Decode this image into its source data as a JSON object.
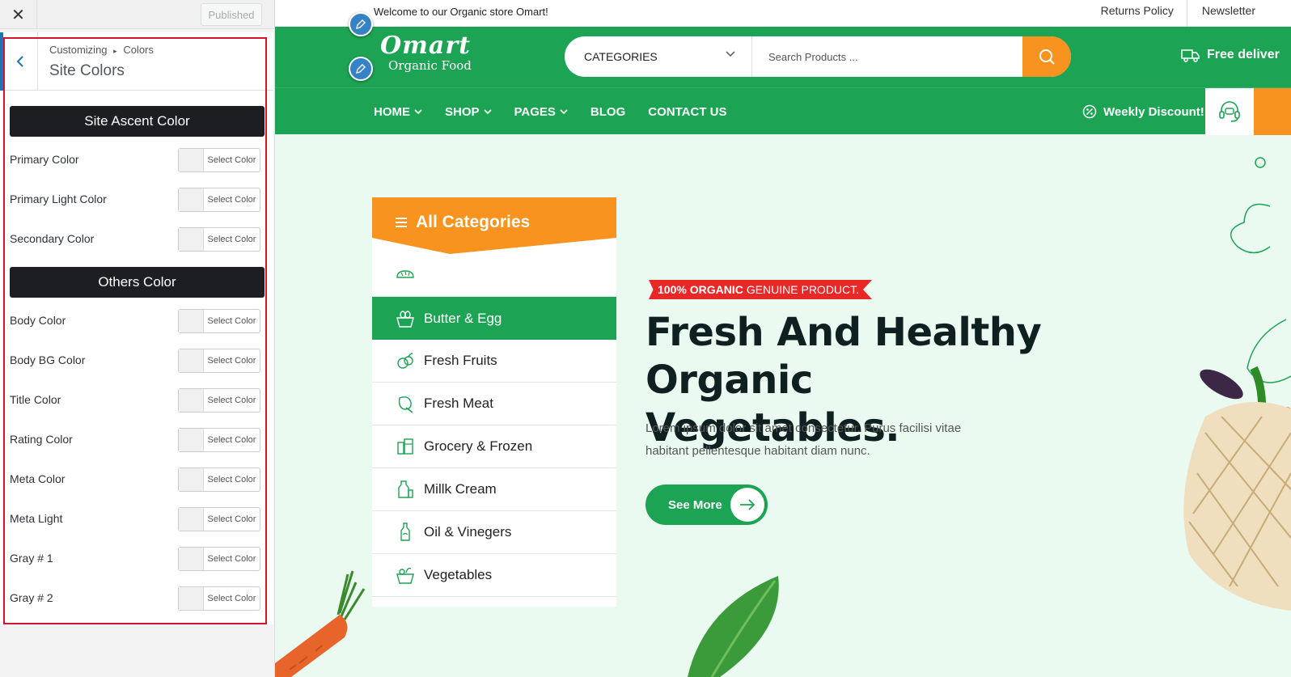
{
  "customizer": {
    "close_glyph": "✕",
    "published_label": "Published",
    "breadcrumb_parent": "Customizing",
    "breadcrumb_sep": "▸",
    "breadcrumb_current": "Colors",
    "panel_title": "Site Colors",
    "picker_label": "Select Color",
    "sections": [
      {
        "title": "Site Ascent Color",
        "fields": [
          "Primary Color",
          "Primary Light Color",
          "Secondary Color"
        ]
      },
      {
        "title": "Others Color",
        "fields": [
          "Body Color",
          "Body BG Color",
          "Title Color",
          "Rating Color",
          "Meta Color",
          "Meta Light",
          "Gray # 1",
          "Gray # 2"
        ]
      }
    ],
    "colors": {
      "outline": "#d5152b",
      "accent": "#2271b1",
      "section_bg": "#1d1e22"
    }
  },
  "site": {
    "welcome": "Welcome to our Organic store Omart!",
    "top_links": [
      "Returns Policy",
      "Newsletter"
    ],
    "logo_name": "Omart",
    "logo_tagline": "Organic Food",
    "search": {
      "category_label": "CATEGORIES",
      "placeholder": "Search Products ..."
    },
    "free_delivery": "Free deliver",
    "nav": [
      {
        "label": "HOME",
        "dropdown": true
      },
      {
        "label": "SHOP",
        "dropdown": true
      },
      {
        "label": "PAGES",
        "dropdown": true
      },
      {
        "label": "BLOG",
        "dropdown": false
      },
      {
        "label": "CONTACT US",
        "dropdown": false
      }
    ],
    "weekly_discount": "Weekly Discount!",
    "categories_header": "All Categories",
    "categories": [
      {
        "label": "",
        "icon": "bread-icon",
        "active": false
      },
      {
        "label": "Butter & Egg",
        "icon": "egg-basket-icon",
        "active": true
      },
      {
        "label": "Fresh Fruits",
        "icon": "fruit-icon",
        "active": false
      },
      {
        "label": "Fresh Meat",
        "icon": "meat-icon",
        "active": false
      },
      {
        "label": "Grocery & Frozen",
        "icon": "grocery-icon",
        "active": false
      },
      {
        "label": "Millk Cream",
        "icon": "milk-icon",
        "active": false
      },
      {
        "label": "Oil & Vinegers",
        "icon": "oil-bottle-icon",
        "active": false
      },
      {
        "label": "Vegetables",
        "icon": "vegetable-basket-icon",
        "active": false
      }
    ],
    "hero": {
      "badge_strong": "100% ORGANIC",
      "badge_rest": "GENUINE PRODUCT.",
      "title_line1": "Fresh And Healthy",
      "title_line2": "Organic Vegetables.",
      "description": "Lorem ipsum dolor sit amet consectetur. Purus facilisi vitae habitant pellentesque habitant diam nunc.",
      "cta": "See More"
    },
    "colors": {
      "green": "#1ca353",
      "orange": "#f7931e",
      "red": "#e82727",
      "hero_bg": "#eafaf1"
    }
  }
}
